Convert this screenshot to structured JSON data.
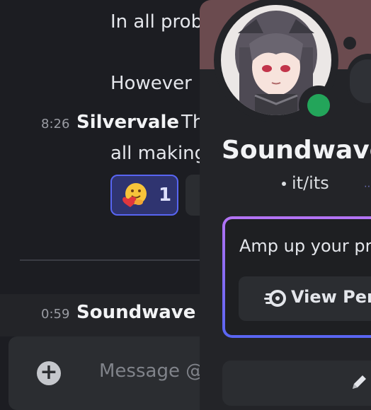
{
  "chat": {
    "messages": [
      {
        "text": "In all prob"
      },
      {
        "text": "However"
      },
      {
        "time": "8:26",
        "author": "Silvervale",
        "text_line1": "Th",
        "text_line2": "all making"
      },
      {
        "time": "0:59",
        "author": "Soundwave"
      }
    ],
    "reaction": {
      "emoji_name": "hugging-face-heart",
      "count": "1"
    },
    "composer": {
      "placeholder": "Message @",
      "plus_icon": "plus-circle-icon"
    }
  },
  "profile": {
    "display_name": "Soundwave",
    "pronouns": "it/its",
    "status": "online",
    "colors": {
      "status": "#23a55a",
      "banner": "#6b4b4f",
      "nitro_border_top": "#b473f5",
      "nitro_border_bottom": "#5865f2"
    },
    "nitro_promo": {
      "text": "Amp up your pro",
      "button_label": "View Perk",
      "button_icon": "nitro-icon"
    },
    "edit_icon": "pencil-icon"
  }
}
